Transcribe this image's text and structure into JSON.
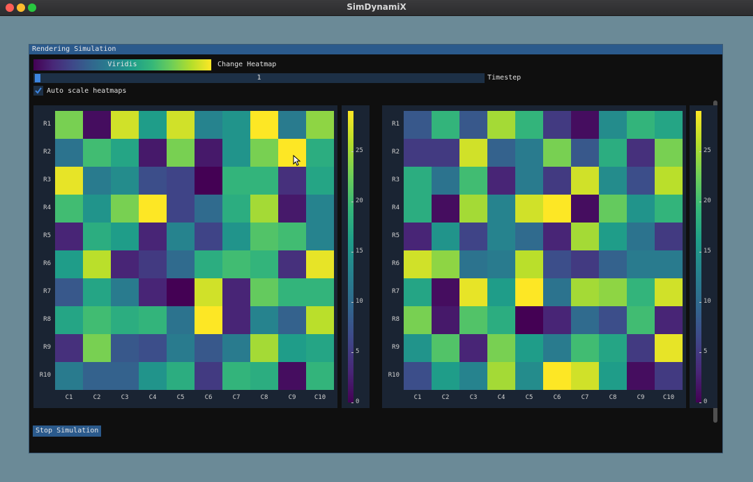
{
  "app": {
    "title": "SimDynamiX"
  },
  "window": {
    "title": "Rendering Simulation"
  },
  "controls": {
    "colormap_label": "Viridis",
    "change_heatmap_label": "Change Heatmap",
    "timestep_value": "1",
    "timestep_label": "Timestep",
    "auto_scale_label": "Auto scale heatmaps",
    "auto_scale_checked": true,
    "stop_label": "Stop Simulation"
  },
  "colormap_stops": [
    "#440154",
    "#482878",
    "#3e4989",
    "#31688e",
    "#26828e",
    "#1f9e89",
    "#35b779",
    "#6ece58",
    "#b5de2b",
    "#fde725"
  ],
  "chart_data": [
    {
      "type": "heatmap",
      "rows": [
        "R1",
        "R2",
        "R3",
        "R4",
        "R5",
        "R6",
        "R7",
        "R8",
        "R9",
        "R10"
      ],
      "cols": [
        "C1",
        "C2",
        "C3",
        "C4",
        "C5",
        "C6",
        "C7",
        "C8",
        "C9",
        "C10"
      ],
      "colorbar_ticks": [
        "0",
        "5",
        "10",
        "15",
        "20",
        "25"
      ],
      "range": [
        0,
        29
      ],
      "values": [
        [
          23,
          1,
          27,
          16,
          27,
          13,
          15,
          29,
          12,
          24
        ],
        [
          11,
          20,
          17,
          2,
          23,
          2,
          15,
          23,
          29,
          18
        ],
        [
          28,
          12,
          14,
          7,
          6,
          0,
          19,
          19,
          4,
          17
        ],
        [
          20,
          15,
          23,
          29,
          6,
          10,
          18,
          25,
          2,
          13
        ],
        [
          3,
          18,
          16,
          3,
          13,
          6,
          15,
          21,
          20,
          13
        ],
        [
          16,
          26,
          3,
          5,
          10,
          18,
          20,
          19,
          4,
          28
        ],
        [
          8,
          17,
          12,
          3,
          0,
          27,
          3,
          22,
          19,
          19
        ],
        [
          17,
          20,
          18,
          19,
          11,
          29,
          3,
          13,
          9,
          26
        ],
        [
          4,
          23,
          8,
          7,
          12,
          8,
          12,
          25,
          16,
          17
        ],
        [
          12,
          9,
          9,
          15,
          18,
          5,
          19,
          18,
          1,
          19
        ]
      ]
    },
    {
      "type": "heatmap",
      "rows": [
        "R1",
        "R2",
        "R3",
        "R4",
        "R5",
        "R6",
        "R7",
        "R8",
        "R9",
        "R10"
      ],
      "cols": [
        "C1",
        "C2",
        "C3",
        "C4",
        "C5",
        "C6",
        "C7",
        "C8",
        "C9",
        "C10"
      ],
      "colorbar_ticks": [
        "0",
        "5",
        "10",
        "15",
        "20",
        "25"
      ],
      "range": [
        0,
        29
      ],
      "values": [
        [
          8,
          19,
          8,
          25,
          19,
          5,
          1,
          14,
          19,
          17
        ],
        [
          5,
          5,
          27,
          9,
          12,
          23,
          8,
          18,
          4,
          23
        ],
        [
          18,
          11,
          20,
          3,
          12,
          5,
          27,
          14,
          7,
          26
        ],
        [
          18,
          1,
          25,
          13,
          27,
          29,
          1,
          22,
          15,
          19
        ],
        [
          3,
          15,
          6,
          13,
          10,
          3,
          25,
          16,
          11,
          5
        ],
        [
          27,
          24,
          11,
          12,
          26,
          7,
          5,
          9,
          12,
          12
        ],
        [
          17,
          1,
          28,
          16,
          29,
          11,
          25,
          24,
          19,
          27
        ],
        [
          23,
          2,
          21,
          18,
          0,
          3,
          10,
          7,
          20,
          3
        ],
        [
          15,
          21,
          3,
          23,
          16,
          12,
          20,
          17,
          5,
          28
        ],
        [
          7,
          16,
          13,
          25,
          14,
          29,
          27,
          16,
          1,
          5
        ]
      ]
    }
  ]
}
